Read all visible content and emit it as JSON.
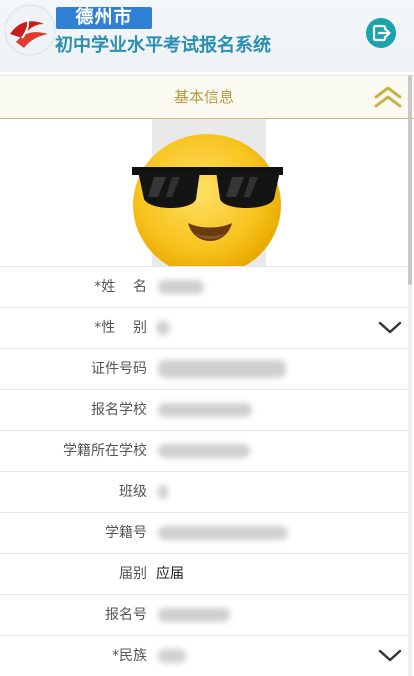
{
  "header": {
    "city": "德州市",
    "system_title": "初中学业水平考试报名系统",
    "logo_icon": "red-ribbon-logo-icon",
    "exit_icon": "logout-icon",
    "accent_color": "#2f7fd4",
    "exit_color": "#18a3ad"
  },
  "section": {
    "title": "基本信息",
    "collapse_icon": "double-chevron-up-icon",
    "title_color": "#b69a3c"
  },
  "avatar": {
    "overlay_icon": "sunglasses-emoji-icon"
  },
  "form": {
    "fields": [
      {
        "label": "*姓    名",
        "value": "",
        "blurred": true
      },
      {
        "label": "*性    别",
        "value": "",
        "blurred": true,
        "dropdown": true
      },
      {
        "label": "证件号码",
        "value": "",
        "blurred": true
      },
      {
        "label": "报名学校",
        "value": "",
        "blurred": true
      },
      {
        "label": "学籍所在学校",
        "value": "",
        "blurred": true
      },
      {
        "label": "班级",
        "value": "",
        "blurred": true
      },
      {
        "label": "学籍号",
        "value": "",
        "blurred": true
      },
      {
        "label": "届别",
        "value": "应届",
        "blurred": false
      },
      {
        "label": "报名号",
        "value": "",
        "blurred": true
      },
      {
        "label": "*民族",
        "value": "",
        "blurred": true,
        "dropdown": true
      }
    ]
  }
}
